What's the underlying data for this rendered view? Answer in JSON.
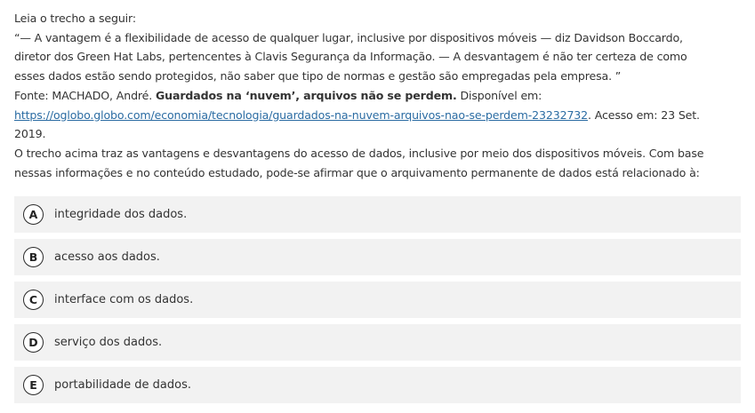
{
  "question": {
    "intro": "Leia o trecho a seguir:",
    "quote_line1": " “— A vantagem é a flexibilidade de acesso de qualquer lugar, inclusive por dispositivos móveis — diz Davidson Boccardo,",
    "quote_line2": "diretor dos Green Hat Labs, pertencentes à Clavis Segurança da Informação. — A desvantagem é não ter certeza de como",
    "quote_line3": "esses dados estão sendo protegidos, não saber que tipo de normas e gestão são empregadas pela empresa. ”",
    "source_prefix": "Fonte: MACHADO, André. ",
    "source_title": "Guardados na ‘nuvem’, arquivos não se perdem.",
    "source_suffix": " Disponível em:",
    "link": "https://oglobo.globo.com/economia/tecnologia/guardados-na-nuvem-arquivos-nao-se-perdem-23232732",
    "access_text": ". Acesso em: 23 Set.",
    "year": "2019.",
    "prompt_line1": "O trecho acima traz as vantagens e desvantagens do acesso de dados, inclusive por meio dos dispositivos móveis. Com base",
    "prompt_line2": "nessas informações e no conteúdo estudado, pode-se afirmar que o arquivamento permanente de dados está relacionado à:"
  },
  "options": [
    {
      "letter": "A",
      "text": "integridade dos dados."
    },
    {
      "letter": "B",
      "text": "acesso aos dados."
    },
    {
      "letter": "C",
      "text": "interface com os dados."
    },
    {
      "letter": "D",
      "text": "serviço dos dados."
    },
    {
      "letter": "E",
      "text": "portabilidade de dados."
    }
  ]
}
